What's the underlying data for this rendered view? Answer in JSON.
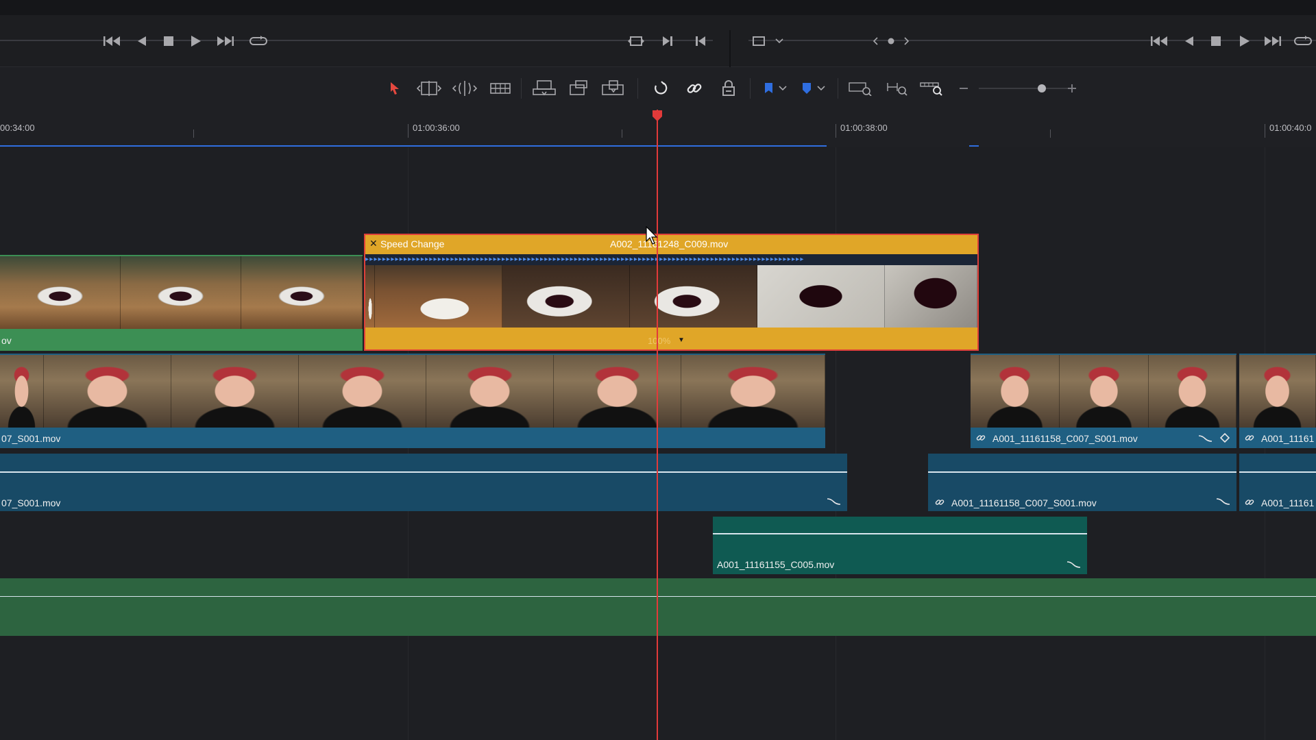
{
  "ruler": {
    "timecodes": [
      "00:34:00",
      "01:00:36:00",
      "01:00:38:00",
      "01:00:40:0"
    ]
  },
  "clips": {
    "speed_change": {
      "title": "Speed Change",
      "name": "A002_11161248_C009.mov",
      "speed": "100%",
      "accent": "#e0a628",
      "border": "#e0403a"
    },
    "green_video": {
      "name": "ov",
      "color": "#3c8f54"
    },
    "blue_video_1": {
      "name": "07_S001.mov",
      "color": "#1f5f82"
    },
    "blue_video_2": {
      "name": "A001_11161158_C007_S001.mov",
      "color": "#1f5f82"
    },
    "blue_video_3": {
      "name": "A001_11161",
      "color": "#1f5f82"
    },
    "audio_1": {
      "name": "07_S001.mov",
      "color": "#184a66"
    },
    "audio_2": {
      "name": "A001_11161158_C007_S001.mov",
      "color": "#184a66"
    },
    "audio_3": {
      "name": "A001_11161",
      "color": "#184a66"
    },
    "audio_4": {
      "name": "A001_11161155_C005.mov",
      "color": "#0f5a52"
    },
    "music_track": {
      "color": "#2d6440"
    }
  },
  "icons": [
    "skip-back-icon",
    "step-back-icon",
    "stop-icon",
    "play-icon",
    "skip-forward-icon",
    "loop-icon",
    "match-frame-icon",
    "next-edit-icon",
    "prev-edit-icon",
    "viewer-mode-icon",
    "chevron-down-icon",
    "selection-tool-icon",
    "trim-tool-icon",
    "dynamic-trim-icon",
    "blade-tool-icon",
    "insert-clip-icon",
    "overwrite-clip-icon",
    "replace-clip-icon",
    "snapping-icon",
    "linked-selection-icon",
    "position-lock-icon",
    "flag-icon",
    "marker-icon",
    "zoom-full-icon",
    "zoom-detail-icon",
    "zoom-custom-icon",
    "zoom-out-icon",
    "zoom-in-icon"
  ],
  "colors": {
    "playhead": "#e23a3a",
    "selection_tool": "#e5483f",
    "flag": "#2f6ee0",
    "marker": "#2f6ee0"
  }
}
